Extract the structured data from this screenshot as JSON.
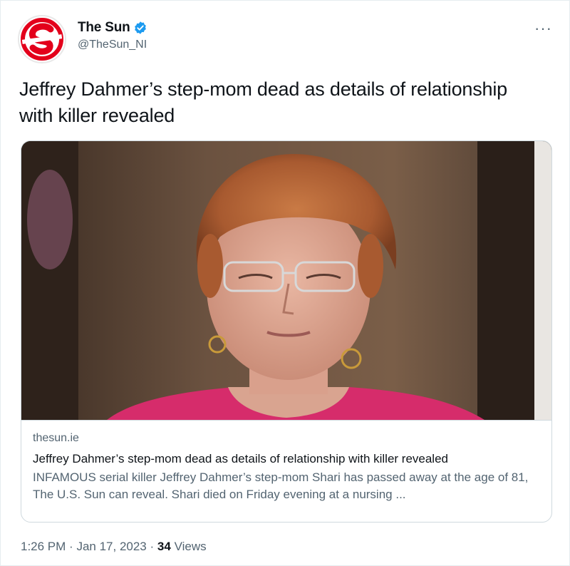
{
  "author": {
    "display_name": "The Sun",
    "handle": "@TheSun_NI",
    "avatar_icon": "the-sun-logo-icon",
    "verified_icon": "verified-badge-icon",
    "brand_color": "#e3001b"
  },
  "tweet": {
    "text": "Jeffrey Dahmer’s step-mom dead as details of relationship with killer revealed",
    "more_icon": "more-options-icon"
  },
  "link_card": {
    "domain": "thesun.ie",
    "title": "Jeffrey Dahmer’s step-mom dead as details of relationship with killer revealed",
    "description": "INFAMOUS serial killer Jeffrey Dahmer’s step-mom Shari has passed away at the age of 81, The U.S. Sun can reveal.  Shari died on Friday evening at a nursing ..."
  },
  "meta": {
    "time": "1:26 PM",
    "separator": "·",
    "date": "Jan 17, 2023",
    "views_count": "34",
    "views_label": "Views"
  }
}
